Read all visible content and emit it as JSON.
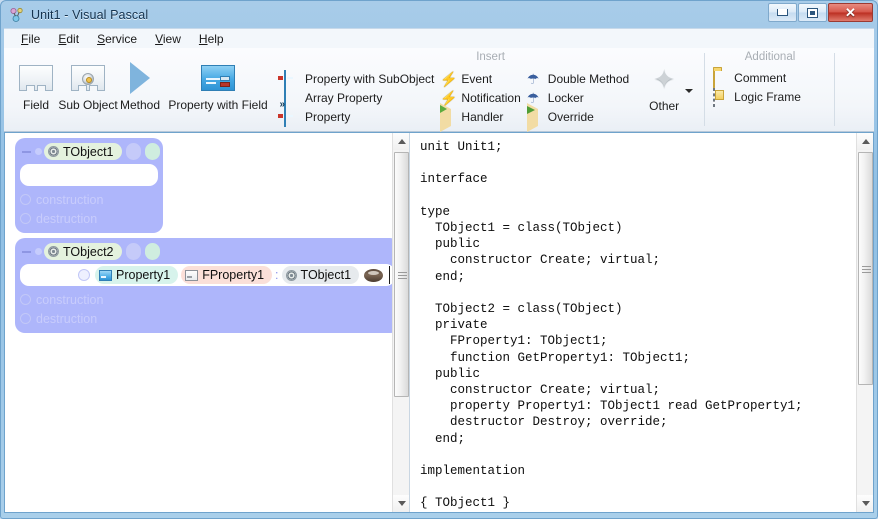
{
  "window": {
    "title": "Unit1 - Visual Pascal",
    "app_icon": "visual-pascal-icon",
    "buttons": {
      "minimize": "minimize-icon",
      "maximize": "maximize-icon",
      "close": "close-icon"
    }
  },
  "menu": {
    "items": [
      {
        "mnemonic": "F",
        "rest": "ile"
      },
      {
        "mnemonic": "E",
        "rest": "dit"
      },
      {
        "mnemonic": "S",
        "rest": "ervice"
      },
      {
        "mnemonic": "V",
        "rest": "iew"
      },
      {
        "mnemonic": "H",
        "rest": "elp"
      }
    ]
  },
  "ribbon": {
    "groups": [
      {
        "caption": "",
        "big_buttons": [
          {
            "label": "Field",
            "icon": "field-icon"
          },
          {
            "label": "Sub Object",
            "icon": "sub-object-icon"
          },
          {
            "label": "Method",
            "icon": "method-icon"
          },
          {
            "label": "Property with Field",
            "icon": "property-with-field-icon"
          }
        ]
      },
      {
        "caption": "Insert",
        "col1": [
          {
            "label": "Property with SubObject",
            "icon": "property-subobject-icon"
          },
          {
            "label": "Array Property",
            "icon": "array-property-icon"
          },
          {
            "label": "Property",
            "icon": "property-icon"
          }
        ],
        "col2": [
          {
            "label": "Event",
            "icon": "event-bolt-icon"
          },
          {
            "label": "Notification",
            "icon": "notification-bolt-icon"
          },
          {
            "label": "Handler",
            "icon": "handler-flag-icon"
          }
        ],
        "col3": [
          {
            "label": "Double Method",
            "icon": "double-method-umbrella-icon"
          },
          {
            "label": "Locker",
            "icon": "locker-umbrella-icon"
          },
          {
            "label": "Override",
            "icon": "override-pen-icon"
          }
        ],
        "other": {
          "label": "Other",
          "icon": "other-star-icon",
          "caret": "chevron-down-icon"
        }
      },
      {
        "caption": "Additional",
        "items": [
          {
            "label": "Comment",
            "icon": "comment-icon"
          },
          {
            "label": "Logic Frame",
            "icon": "logic-frame-icon"
          }
        ]
      }
    ]
  },
  "diagram": {
    "nodes": [
      {
        "name": "TObject1",
        "collapse": "collapse-minus-icon",
        "type_icon": "class-target-icon",
        "badges": [
          "badge-blue",
          "badge-green"
        ],
        "field_value": "",
        "stubs": [
          "construction",
          "destruction"
        ]
      },
      {
        "name": "TObject2",
        "collapse": "collapse-minus-icon",
        "type_icon": "class-target-icon",
        "badges": [
          "badge-blue",
          "badge-green"
        ],
        "member": {
          "property_name": "Property1",
          "property_icon": "property-icon",
          "field_name": "FProperty1",
          "field_icon": "field-gray-icon",
          "separator": ":",
          "type_name": "TObject1",
          "type_icon": "class-target-icon",
          "trailing_icon": "ufo-icon"
        },
        "stubs": [
          "construction",
          "destruction"
        ]
      }
    ]
  },
  "editor": {
    "code": "unit Unit1;\n\ninterface\n\ntype\n  TObject1 = class(TObject)\n  public\n    constructor Create; virtual;\n  end;\n\n  TObject2 = class(TObject)\n  private\n    FProperty1: TObject1;\n    function GetProperty1: TObject1;\n  public\n    constructor Create; virtual;\n    property Property1: TObject1 read GetProperty1;\n    destructor Destroy; override;\n  end;\n\nimplementation\n\n{ TObject1 }"
  },
  "scrollbars": {
    "left": {
      "up": "scroll-up-icon",
      "down": "scroll-down-icon"
    },
    "right": {
      "up": "scroll-up-icon",
      "down": "scroll-down-icon"
    }
  },
  "colors": {
    "titlebar": "#8fbfe4",
    "node_body": "#aeb6fb",
    "pill_green": "#e4f2de",
    "chip_property": "#d7f3ec",
    "chip_field": "#fbe0d9",
    "accent_blue": "#4fb0e8",
    "close_red": "#bb2f22"
  }
}
